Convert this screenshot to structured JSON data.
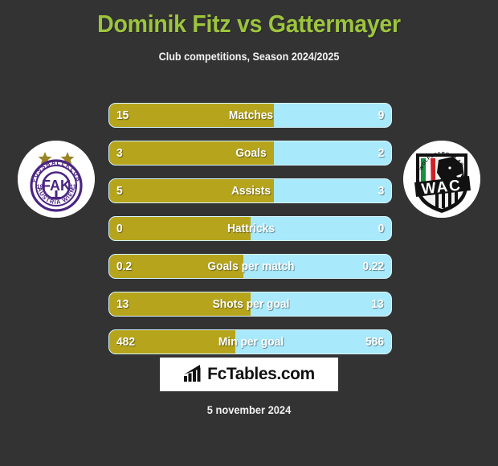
{
  "header": {
    "title": "Dominik Fitz vs Gattermayer",
    "subtitle": "Club competitions, Season 2024/2025",
    "title_color": "#9dc43e",
    "background_color": "#333333"
  },
  "teams": {
    "left": {
      "name": "FK Austria Wien",
      "short": "FAK",
      "founded_top": "19",
      "founded_bottom": "11",
      "ring_top": "FUSSBALLKLUB",
      "ring_bottom": "AUSTRIA WIEN",
      "color": "#4b2582",
      "stars": 2
    },
    "right": {
      "name": "Wolfsberger AC",
      "short": "WAC",
      "ring_top": "WOLFSBERGER AC",
      "color": "#111111"
    }
  },
  "colors": {
    "left_bar": "#b6a51c",
    "right_bar": "#a8e9fb"
  },
  "stats": [
    {
      "label": "Matches",
      "left": "15",
      "right": "9",
      "left_pct": 58.5
    },
    {
      "label": "Goals",
      "left": "3",
      "right": "2",
      "left_pct": 58.5
    },
    {
      "label": "Assists",
      "left": "5",
      "right": "3",
      "left_pct": 58.5
    },
    {
      "label": "Hattricks",
      "left": "0",
      "right": "0",
      "left_pct": 50.0
    },
    {
      "label": "Goals per match",
      "left": "0.2",
      "right": "0.22",
      "left_pct": 47.6
    },
    {
      "label": "Shots per goal",
      "left": "13",
      "right": "13",
      "left_pct": 50.0
    },
    {
      "label": "Min per goal",
      "left": "482",
      "right": "586",
      "left_pct": 44.8
    }
  ],
  "footer": {
    "brand": "FcTables.com",
    "date": "5 november 2024"
  }
}
